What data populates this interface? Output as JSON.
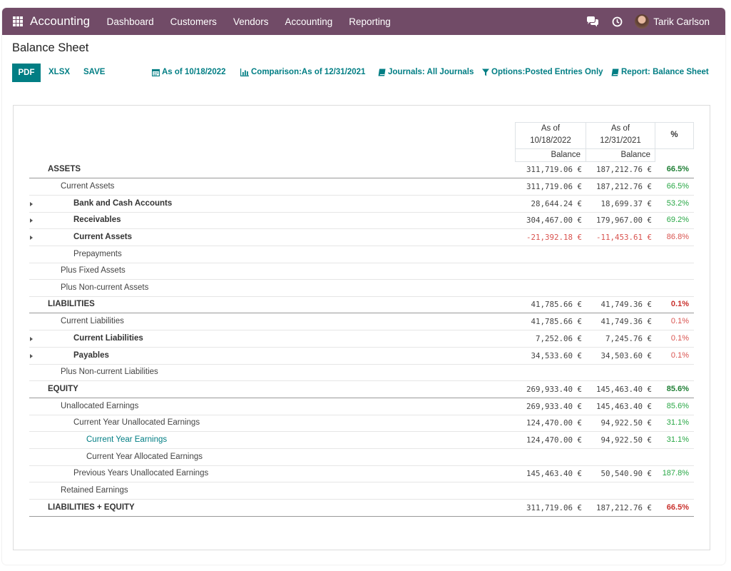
{
  "navbar": {
    "app_title": "Accounting",
    "menu": [
      "Dashboard",
      "Customers",
      "Vendors",
      "Accounting",
      "Reporting"
    ],
    "user_name": "Tarik Carlson",
    "icons": [
      "apps-grid-icon",
      "chat-icon",
      "clock-icon"
    ],
    "color": "#714B67"
  },
  "page": {
    "title": "Balance Sheet"
  },
  "toolbar": {
    "pdf": "PDF",
    "xlsx": "XLSX",
    "save": "SAVE",
    "filters": {
      "date": "As of 10/18/2022",
      "comparison": "Comparison:As of 12/31/2021",
      "journals": "Journals: All Journals",
      "options": "Options:Posted Entries Only",
      "report": "Report: Balance Sheet"
    },
    "accent": "#017e84"
  },
  "table": {
    "col1_header": [
      "As of",
      "10/18/2022"
    ],
    "col2_header": [
      "As of",
      "12/31/2021"
    ],
    "balance_label": "Balance",
    "pct_header": "%",
    "rows": [
      {
        "label": "ASSETS",
        "v1": "311,719.06 €",
        "v2": "187,212.76 €",
        "pct": "66.5%"
      },
      {
        "label": "Current Assets",
        "v1": "311,719.06 €",
        "v2": "187,212.76 €",
        "pct": "66.5%"
      },
      {
        "label": "Bank and Cash Accounts",
        "v1": "28,644.24 €",
        "v2": "18,699.37 €",
        "pct": "53.2%"
      },
      {
        "label": "Receivables",
        "v1": "304,467.00 €",
        "v2": "179,967.00 €",
        "pct": "69.2%"
      },
      {
        "label": "Current Assets",
        "v1": "-21,392.18 €",
        "v2": "-11,453.61 €",
        "pct": "86.8%"
      },
      {
        "label": "Prepayments",
        "v1": "",
        "v2": "",
        "pct": ""
      },
      {
        "label": "Plus Fixed Assets",
        "v1": "",
        "v2": "",
        "pct": ""
      },
      {
        "label": "Plus Non-current Assets",
        "v1": "",
        "v2": "",
        "pct": ""
      },
      {
        "label": "LIABILITIES",
        "v1": "41,785.66 €",
        "v2": "41,749.36 €",
        "pct": "0.1%"
      },
      {
        "label": "Current Liabilities",
        "v1": "41,785.66 €",
        "v2": "41,749.36 €",
        "pct": "0.1%"
      },
      {
        "label": "Current Liabilities",
        "v1": "7,252.06 €",
        "v2": "7,245.76 €",
        "pct": "0.1%"
      },
      {
        "label": "Payables",
        "v1": "34,533.60 €",
        "v2": "34,503.60 €",
        "pct": "0.1%"
      },
      {
        "label": "Plus Non-current Liabilities",
        "v1": "",
        "v2": "",
        "pct": ""
      },
      {
        "label": "EQUITY",
        "v1": "269,933.40 €",
        "v2": "145,463.40 €",
        "pct": "85.6%"
      },
      {
        "label": "Unallocated Earnings",
        "v1": "269,933.40 €",
        "v2": "145,463.40 €",
        "pct": "85.6%"
      },
      {
        "label": "Current Year Unallocated Earnings",
        "v1": "124,470.00 €",
        "v2": "94,922.50 €",
        "pct": "31.1%"
      },
      {
        "label": "Current Year Earnings",
        "v1": "124,470.00 €",
        "v2": "94,922.50 €",
        "pct": "31.1%"
      },
      {
        "label": "Current Year Allocated Earnings",
        "v1": "",
        "v2": "",
        "pct": ""
      },
      {
        "label": "Previous Years Unallocated Earnings",
        "v1": "145,463.40 €",
        "v2": "50,540.90 €",
        "pct": "187.8%"
      },
      {
        "label": "Retained Earnings",
        "v1": "",
        "v2": "",
        "pct": ""
      },
      {
        "label": "LIABILITIES + EQUITY",
        "v1": "311,719.06 €",
        "v2": "187,212.76 €",
        "pct": "66.5%"
      }
    ]
  }
}
